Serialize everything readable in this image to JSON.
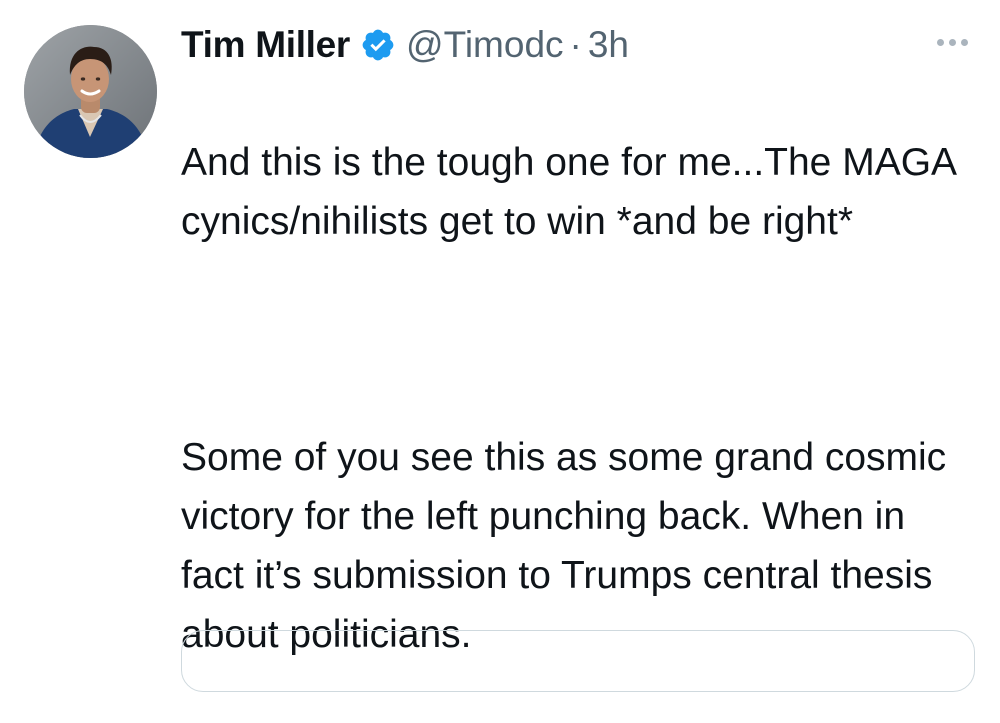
{
  "tweet": {
    "author": {
      "name": "Tim Miller",
      "handle": "@Timodc",
      "verified": true
    },
    "separator": "·",
    "time": "3h",
    "paragraphs": [
      "And this is the tough one for me...The MAGA cynics/nihilists get to win *and be right*",
      "Some of you see this as some grand cosmic victory for the left punching back. When in fact it’s submission to Trumps central thesis about politicians."
    ]
  },
  "icons": {
    "verified": "verified-badge-icon",
    "more": "more-horizontal-icon"
  },
  "colors": {
    "text_primary": "#0f1419",
    "text_secondary": "#536471",
    "verified_blue": "#1d9bf0",
    "border": "#cfd9de"
  }
}
